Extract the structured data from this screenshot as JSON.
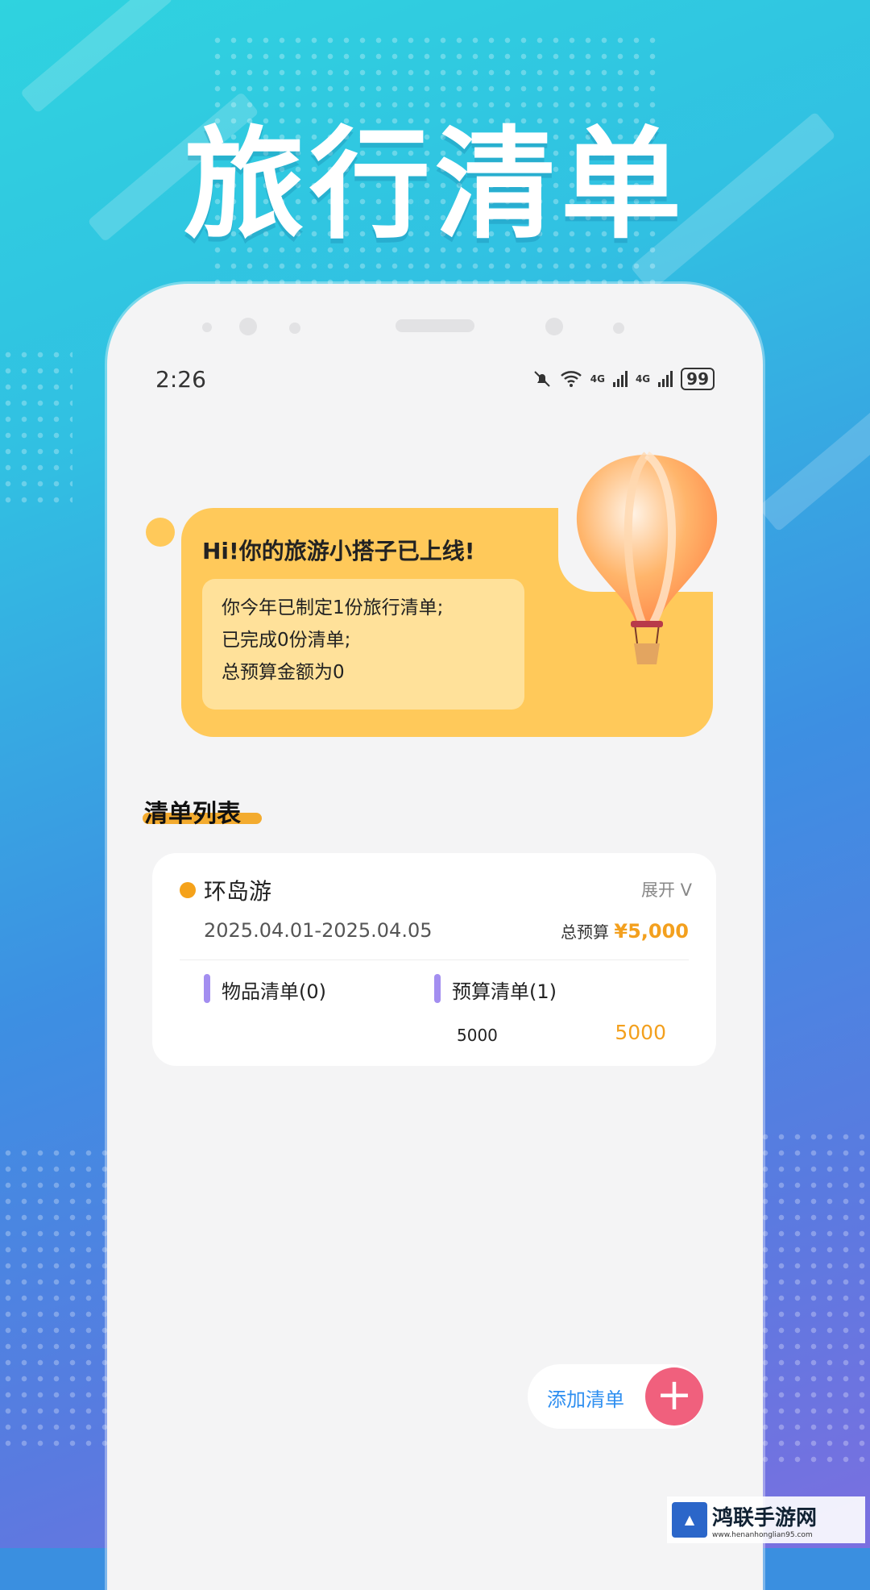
{
  "poster": {
    "title": "旅行清单"
  },
  "status_bar": {
    "time": "2:26",
    "battery": "99",
    "network1": "4G",
    "network2": "4G"
  },
  "greeting": {
    "title": "Hi!你的旅游小搭子已上线!",
    "lines": [
      "你今年已制定1份旅行清单;",
      "已完成0份清单;",
      "总预算金额为0"
    ]
  },
  "list_section": {
    "title": "清单列表"
  },
  "trip": {
    "name": "环岛游",
    "expand_label": "展开 V",
    "date_range": "2025.04.01-2025.04.05",
    "budget_label": "总预算",
    "budget_amount": "¥5,000",
    "items_tab": "物品清单(0)",
    "budget_tab": "预算清单(1)",
    "budget_item_name": "5000",
    "budget_item_value": "5000"
  },
  "add_button": {
    "label": "添加清单",
    "icon": "+"
  },
  "watermark": {
    "name": "鸿联手游网",
    "url": "www.henanhonglian95.com"
  },
  "colors": {
    "accent_orange": "#f3a01e",
    "bubble_yellow": "#ffc95a",
    "add_pink": "#f0607d",
    "add_blue": "#2f8ff0"
  }
}
